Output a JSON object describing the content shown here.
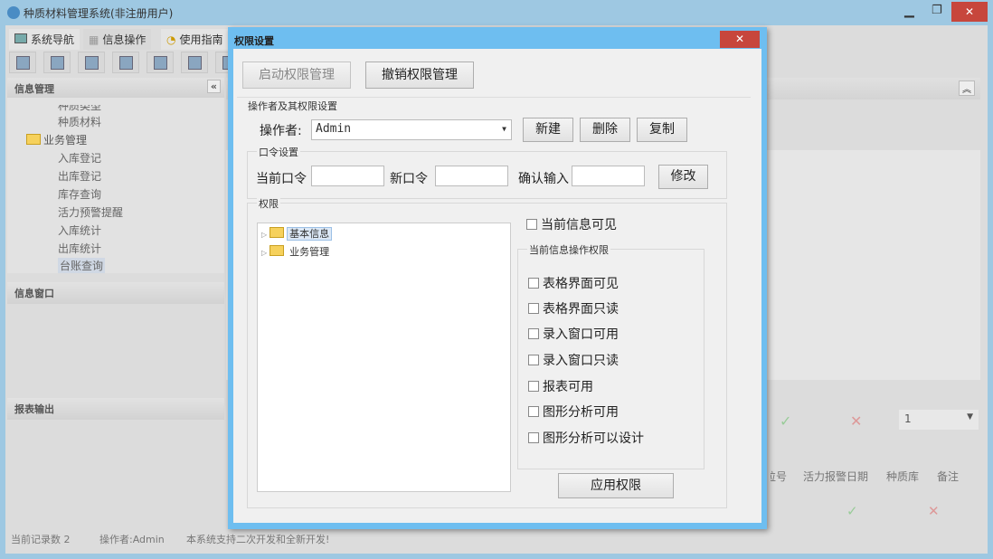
{
  "app": {
    "title": "种质材料管理系统(非注册用户)",
    "tabs": [
      "系统导航",
      "信息操作",
      "使用指南"
    ]
  },
  "left": {
    "panel1": "信息管理",
    "tree": [
      "种质类型",
      "种质材料",
      "业务管理",
      "入库登记",
      "出库登记",
      "库存查询",
      "活力预警提醒",
      "入库统计",
      "出库统计",
      "台账查询"
    ],
    "panel2": "信息窗口",
    "panel3": "报表输出"
  },
  "right": {
    "page_select": "1",
    "columns": [
      "粒号",
      "活力报警日期",
      "种质库",
      "备注"
    ]
  },
  "status": {
    "records": "当前记录数 2",
    "operator": "操作者:Admin",
    "note": "本系统支持二次开发和全新开发!"
  },
  "dialog": {
    "title": "权限设置",
    "close": "✕",
    "start": "启动权限管理",
    "revoke": "撤销权限管理",
    "section": "操作者及其权限设置",
    "operator_label": "操作者:",
    "operator_value": "Admin",
    "new": "新建",
    "delete": "删除",
    "copy": "复制",
    "pwd_group": "口令设置",
    "cur_pwd": "当前口令",
    "new_pwd": "新口令",
    "confirm_pwd": "确认输入",
    "modify": "修改",
    "perm_group": "权限",
    "tree": [
      "基本信息",
      "业务管理"
    ],
    "visible": "当前信息可见",
    "ops_group": "当前信息操作权限",
    "ops": [
      "表格界面可见",
      "表格界面只读",
      "录入窗口可用",
      "录入窗口只读",
      "报表可用",
      "图形分析可用",
      "图形分析可以设计"
    ],
    "apply": "应用权限"
  }
}
